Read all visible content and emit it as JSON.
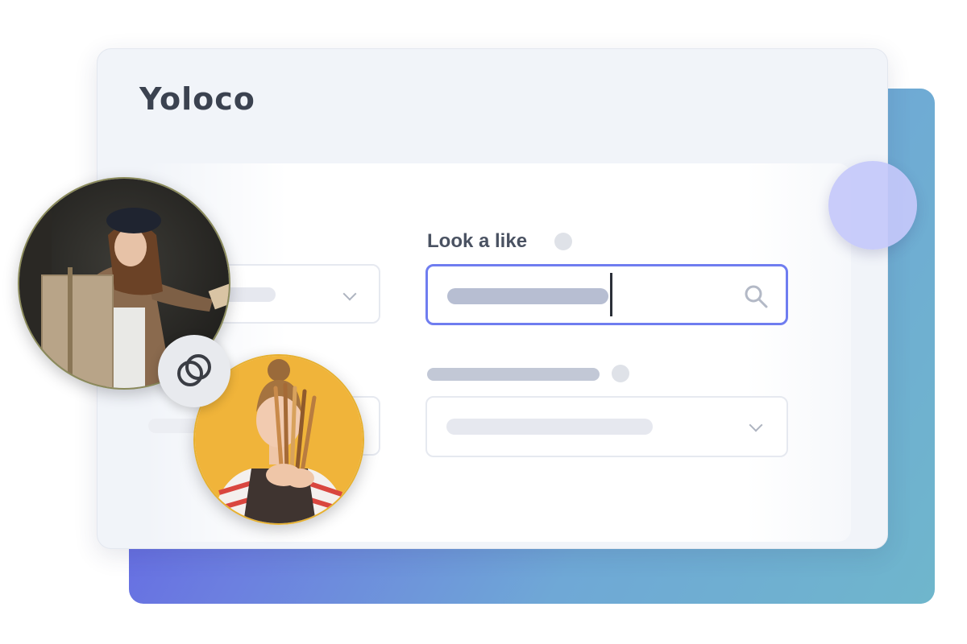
{
  "app": {
    "brand": "Yoloco"
  },
  "form": {
    "look_alike": {
      "label": "Look a like"
    }
  },
  "icons": {
    "search": "search-icon",
    "chevron": "chevron-down-icon",
    "info": "info-dot-icon",
    "link": "link-rings-icon"
  },
  "colors": {
    "accent": "#6f7df0",
    "brand_text": "#3b4250",
    "placeholder_bar": "#b7bed2",
    "placeholder_bar_light": "#e6e8ef",
    "backdrop_start": "#5b4ee6",
    "backdrop_end": "#6fb6cc"
  }
}
